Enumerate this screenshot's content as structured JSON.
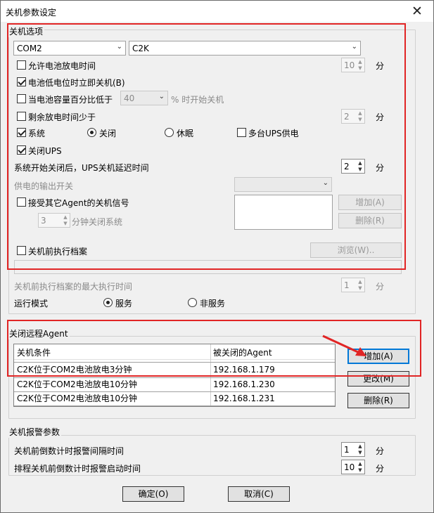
{
  "window": {
    "title": "关机参数设定",
    "close_glyph": "✕"
  },
  "shutdown_options": {
    "group_label": "关机选项",
    "port_combo": "COM2",
    "device_combo": "C2K",
    "allow_battery_time_label": "允许电池放电时间",
    "allow_battery_time_value": "10",
    "battery_low_label": "电池低电位时立即关机(B)",
    "capacity_below_label": "当电池容量百分比低于",
    "capacity_value": "40",
    "capacity_suffix": "% 时开始关机",
    "remaining_time_label": "剩余放电时间少于",
    "remaining_time_value": "2",
    "minute_unit": "分",
    "system_label": "系统",
    "radio_close_label": "关闭",
    "radio_sleep_label": "休眠",
    "multi_ups_label": "多台UPS供电",
    "close_ups_label": "关闭UPS",
    "ups_delay_label": "系统开始关闭后，UPS关机延迟时间",
    "ups_delay_value": "2",
    "output_switch_label": "供电的输出开关",
    "accept_agent_label": "接受其它Agent的关机信号",
    "agent_minutes_value": "3",
    "agent_minutes_suffix": "分钟关闭系统",
    "add_button": "增加(A)",
    "delete_button": "删除(R)",
    "pre_shutdown_file_label": "关机前执行档案",
    "browse_button": "浏览(W)..",
    "max_exec_time_label": "关机前执行档案的最大执行时间",
    "max_exec_time_value": "1",
    "run_mode_label": "运行模式",
    "service_label": "服务",
    "non_service_label": "非服务"
  },
  "remote_agent": {
    "group_label": "关闭远程Agent",
    "columns": [
      "关机条件",
      "被关闭的Agent"
    ],
    "rows": [
      [
        "C2K位于COM2电池放电3分钟",
        "192.168.1.179"
      ],
      [
        "C2K位于COM2电池放电10分钟",
        "192.168.1.230"
      ],
      [
        "C2K位于COM2电池放电10分钟",
        "192.168.1.231"
      ]
    ],
    "add_button": "增加(A)",
    "modify_button": "更改(M)",
    "delete_button": "删除(R)"
  },
  "alarm": {
    "group_label": "关机报警参数",
    "countdown_interval_label": "关机前倒数计时报警间隔时间",
    "countdown_interval_value": "1",
    "countdown_start_label": "排程关机前倒数计时报警启动时间",
    "countdown_start_value": "10",
    "minute_unit": "分"
  },
  "footer": {
    "ok_button": "确定(O)",
    "cancel_button": "取消(C)"
  },
  "annotation_color": "#e12525"
}
